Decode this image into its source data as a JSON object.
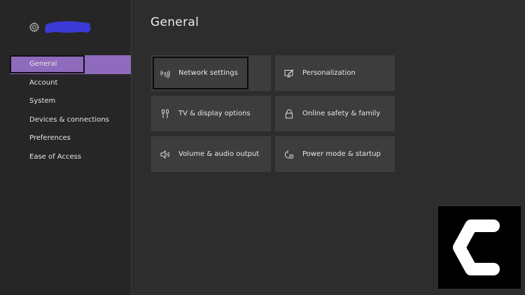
{
  "page": {
    "title": "General"
  },
  "sidebar": {
    "icon": "gear-icon",
    "items": [
      {
        "label": "General",
        "active": true
      },
      {
        "label": "Account",
        "active": false
      },
      {
        "label": "System",
        "active": false
      },
      {
        "label": "Devices & connections",
        "active": false
      },
      {
        "label": "Preferences",
        "active": false
      },
      {
        "label": "Ease of Access",
        "active": false
      }
    ]
  },
  "tiles": [
    {
      "label": "Network settings",
      "icon": "network-icon",
      "focused": true
    },
    {
      "label": "Personalization",
      "icon": "personalization-icon",
      "focused": false
    },
    {
      "label": "TV & display options",
      "icon": "tv-display-icon",
      "focused": false
    },
    {
      "label": "Online safety & family",
      "icon": "lock-icon",
      "focused": false
    },
    {
      "label": "Volume & audio output",
      "icon": "speaker-icon",
      "focused": false
    },
    {
      "label": "Power mode & startup",
      "icon": "power-icon",
      "focused": false
    }
  ],
  "colors": {
    "background": "#2d2d2d",
    "sidebar": "#262626",
    "accent": "#8f6bbd",
    "tile": "#3d3d3d",
    "scribble": "#3b3bd6"
  },
  "logo": {
    "icon": "c-logo-icon"
  }
}
